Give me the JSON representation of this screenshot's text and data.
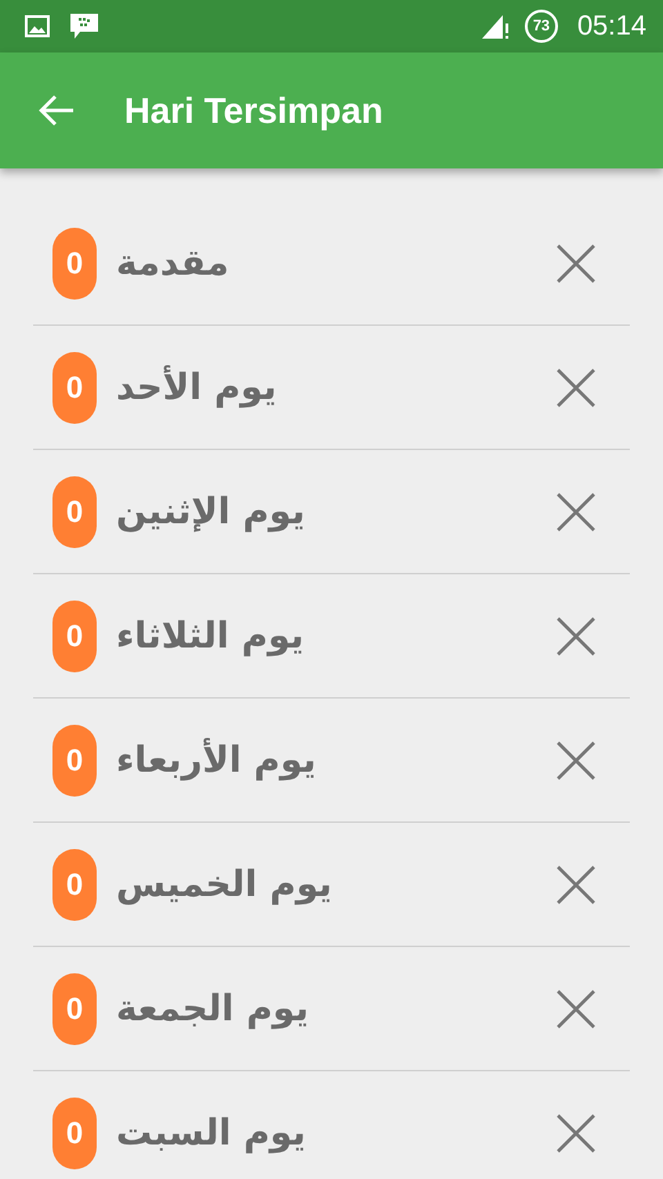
{
  "status_bar": {
    "battery": "73",
    "time": "05:14"
  },
  "app_bar": {
    "title": "Hari Tersimpan"
  },
  "items": [
    {
      "count": "0",
      "title": "مقدمة"
    },
    {
      "count": "0",
      "title": "يوم الأحد"
    },
    {
      "count": "0",
      "title": "يوم الإثنين"
    },
    {
      "count": "0",
      "title": "يوم الثلاثاء"
    },
    {
      "count": "0",
      "title": "يوم الأربعاء"
    },
    {
      "count": "0",
      "title": "يوم الخميس"
    },
    {
      "count": "0",
      "title": "يوم الجمعة"
    },
    {
      "count": "0",
      "title": "يوم السبت"
    }
  ]
}
